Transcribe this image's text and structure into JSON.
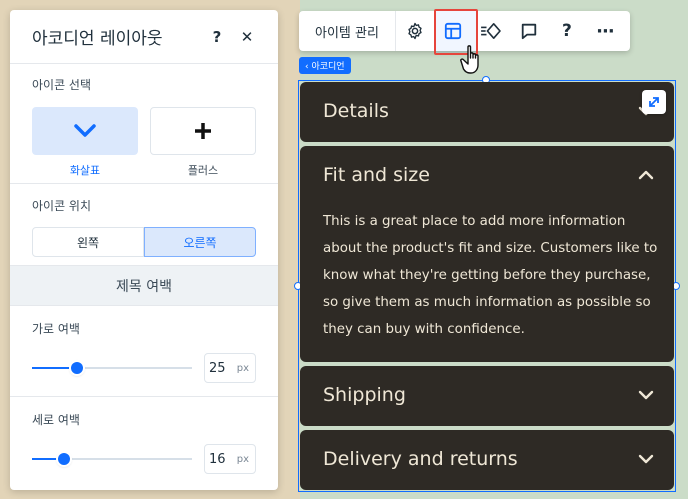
{
  "panel": {
    "title": "아코디언 레이아웃",
    "help_label": "?",
    "close_label": "✕",
    "icon_section": {
      "label": "아이콘 선택",
      "options": [
        {
          "label": "화살표",
          "icon": "chevron-down-icon",
          "selected": true
        },
        {
          "label": "플러스",
          "icon": "plus-icon",
          "selected": false
        }
      ]
    },
    "position_section": {
      "label": "아이콘 위치",
      "options": [
        {
          "label": "왼쪽",
          "selected": false
        },
        {
          "label": "오른쪽",
          "selected": true
        }
      ]
    },
    "spacing_heading": "제목 여백",
    "horizontal": {
      "label": "가로 여백",
      "value": "25",
      "unit": "px",
      "fraction": 0.28
    },
    "vertical": {
      "label": "세로 여백",
      "value": "16",
      "unit": "px",
      "fraction": 0.2
    }
  },
  "toolbar": {
    "manage_items_label": "아이템 관리",
    "icons": [
      "gear-icon",
      "layout-icon",
      "animation-icon",
      "comment-icon",
      "help-icon",
      "more-icon"
    ],
    "help_label": "?",
    "more_label": "···"
  },
  "selection_tag": "‹ 아코디언",
  "accordion": {
    "items": [
      {
        "title": "Details",
        "expanded": false
      },
      {
        "title": "Fit and size",
        "expanded": true,
        "body": "This is a great place to add more information about the product's fit and size. Customers like to know what they're getting before they purchase, so give them as much information as possible so they can buy with confidence."
      },
      {
        "title": "Shipping",
        "expanded": false
      },
      {
        "title": "Delivery and returns",
        "expanded": false
      }
    ]
  },
  "colors": {
    "accent": "#116dff",
    "accordion_bg": "#2e2a25",
    "accordion_text": "#efe7d6",
    "highlight_border": "#e6453c"
  }
}
